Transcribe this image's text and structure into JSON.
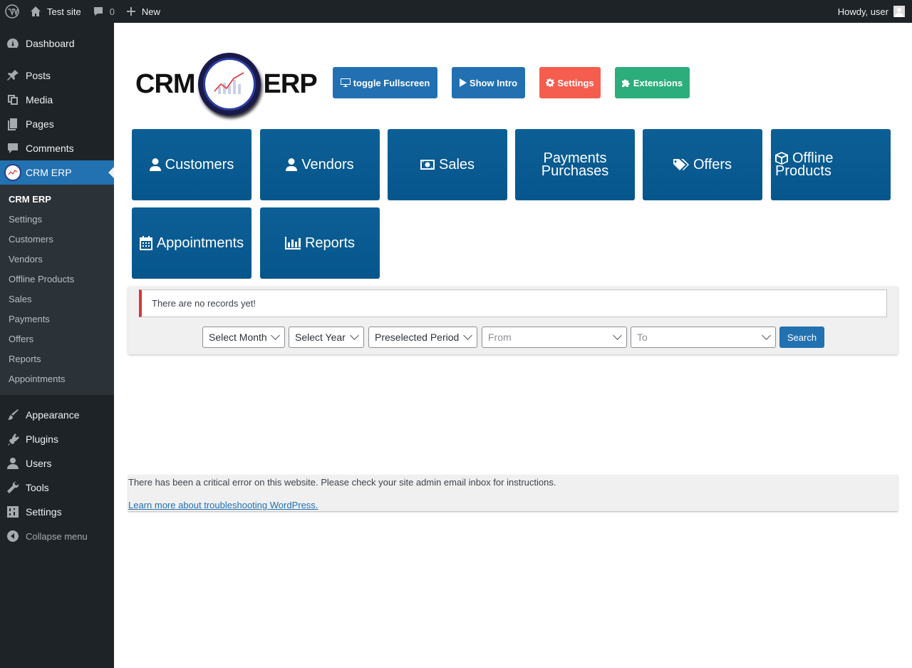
{
  "adminbar": {
    "site_name": "Test site",
    "comments_count": "0",
    "new_label": "New",
    "howdy": "Howdy, user"
  },
  "sidebar": {
    "items_top": [
      {
        "label": "Dashboard",
        "icon": "dashboard-icon"
      },
      {
        "label": "Posts",
        "icon": "pin-icon"
      },
      {
        "label": "Media",
        "icon": "media-icon"
      },
      {
        "label": "Pages",
        "icon": "pages-icon"
      },
      {
        "label": "Comments",
        "icon": "comment-icon"
      }
    ],
    "current": {
      "label": "CRM ERP",
      "icon": "crm-erp-logo-icon"
    },
    "submenu": [
      "CRM ERP",
      "Settings",
      "Customers",
      "Vendors",
      "Offline Products",
      "Sales",
      "Payments",
      "Offers",
      "Reports",
      "Appointments"
    ],
    "items_bottom": [
      {
        "label": "Appearance",
        "icon": "brush-icon"
      },
      {
        "label": "Plugins",
        "icon": "plug-icon"
      },
      {
        "label": "Users",
        "icon": "user-icon"
      },
      {
        "label": "Tools",
        "icon": "wrench-icon"
      },
      {
        "label": "Settings",
        "icon": "sliders-icon"
      }
    ],
    "collapse_label": "Collapse menu"
  },
  "header": {
    "brand_left": "CRM",
    "brand_right": "ERP",
    "buttons": {
      "fullscreen": "toggle Fullscreen",
      "intro": "Show Intro",
      "settings": "Settings",
      "extensions": "Extensions"
    },
    "colors": {
      "blue": "#2270b1",
      "red": "#f55d4e",
      "green": "#2bae7b"
    }
  },
  "tiles": {
    "customers": "Customers",
    "vendors": "Vendors",
    "sales": "Sales",
    "payments_line1": "Payments",
    "payments_line2": "Purchases",
    "offers": "Offers",
    "offline_line1": "Offline",
    "offline_line2": "Products",
    "appointments": "Appointments",
    "reports": "Reports"
  },
  "filter": {
    "notice": "There are no records yet!",
    "month": "Select Month",
    "year": "Select Year",
    "period": "Preselected Period",
    "from": "From",
    "to": "To",
    "search": "Search"
  },
  "error": {
    "message": "There has been a critical error on this website. Please check your site admin email inbox for instructions.",
    "link": "Learn more about troubleshooting WordPress."
  }
}
